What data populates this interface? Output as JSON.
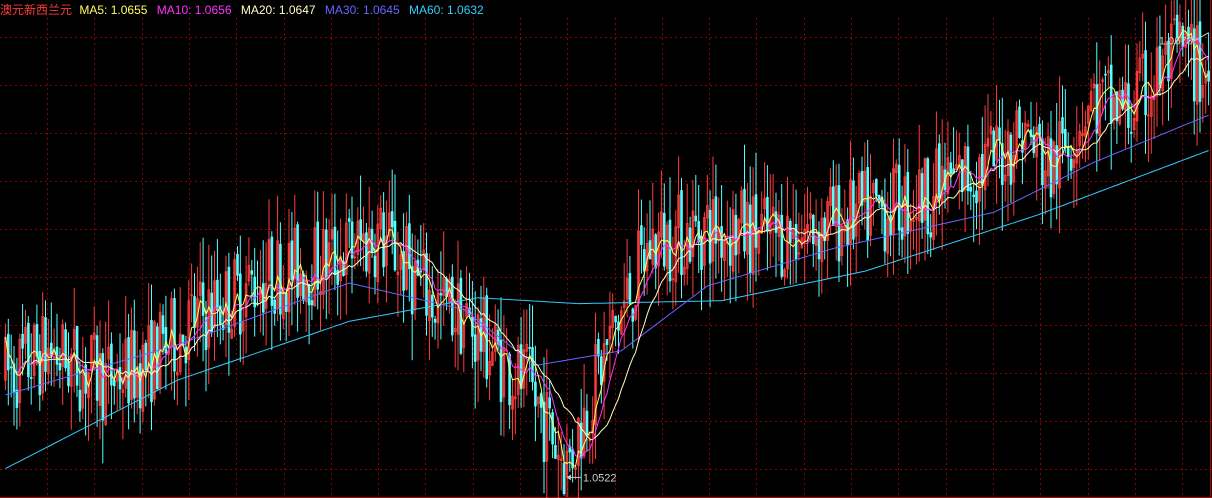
{
  "header": {
    "title": "澳元新西兰元",
    "ma": [
      {
        "label": "MA5:",
        "value": "1.0655"
      },
      {
        "label": "MA10:",
        "value": "1.0656"
      },
      {
        "label": "MA20:",
        "value": "1.0647"
      },
      {
        "label": "MA30:",
        "value": "1.0645"
      },
      {
        "label": "MA60:",
        "value": "1.0632"
      }
    ]
  },
  "colors": {
    "title": "#ff3c3c",
    "ma5": "#ffff66",
    "ma10": "#ff33ff",
    "ma20": "#ffffc0",
    "ma30": "#6666ff",
    "ma60": "#33ccff",
    "up": "#ff3c3c",
    "down": "#55ffff",
    "grid": "#8b0000",
    "annot": "#cccccc"
  },
  "chart_data": {
    "type": "candlestick",
    "title": "澳元新西兰元",
    "ylim": [
      1.0515,
      1.0678
    ],
    "grid": true,
    "high_marker": "1.0673",
    "low_marker": "1.0522",
    "series_names": [
      "MA5",
      "MA10",
      "MA20",
      "MA30",
      "MA60"
    ],
    "latest": {
      "MA5": 1.0655,
      "MA10": 1.0656,
      "MA20": 1.0647,
      "MA30": 1.0645,
      "MA60": 1.0632
    },
    "anchors": [
      [
        0,
        1.0557
      ],
      [
        15,
        1.0565
      ],
      [
        35,
        1.0555
      ],
      [
        50,
        1.0561
      ],
      [
        65,
        1.0575
      ],
      [
        90,
        1.059
      ],
      [
        110,
        1.0595
      ],
      [
        130,
        1.0604
      ],
      [
        135,
        1.06
      ],
      [
        150,
        1.0581
      ],
      [
        158,
        1.0578
      ],
      [
        175,
        1.056
      ],
      [
        183,
        1.0552
      ],
      [
        196,
        1.0526
      ],
      [
        210,
        1.0566
      ],
      [
        225,
        1.0601
      ],
      [
        245,
        1.0607
      ],
      [
        270,
        1.0604
      ],
      [
        295,
        1.061
      ],
      [
        320,
        1.0617
      ],
      [
        345,
        1.063
      ],
      [
        355,
        1.064
      ],
      [
        365,
        1.0626
      ],
      [
        378,
        1.065
      ],
      [
        392,
        1.0646
      ],
      [
        410,
        1.0667
      ],
      [
        420,
        1.0658
      ]
    ],
    "ma_anchors": {
      "MA60": [
        [
          0,
          1.0525
        ],
        [
          60,
          1.0555
        ],
        [
          120,
          1.0575
        ],
        [
          165,
          1.0583
        ],
        [
          200,
          1.0581
        ],
        [
          250,
          1.0582
        ],
        [
          300,
          1.0592
        ],
        [
          360,
          1.0611
        ],
        [
          420,
          1.0633
        ]
      ],
      "MA30": [
        [
          0,
          1.055
        ],
        [
          60,
          1.0567
        ],
        [
          120,
          1.0588
        ],
        [
          160,
          1.0579
        ],
        [
          185,
          1.056
        ],
        [
          215,
          1.0565
        ],
        [
          245,
          1.0587
        ],
        [
          290,
          1.06
        ],
        [
          345,
          1.0612
        ],
        [
          380,
          1.0629
        ],
        [
          420,
          1.0645
        ]
      ]
    }
  }
}
